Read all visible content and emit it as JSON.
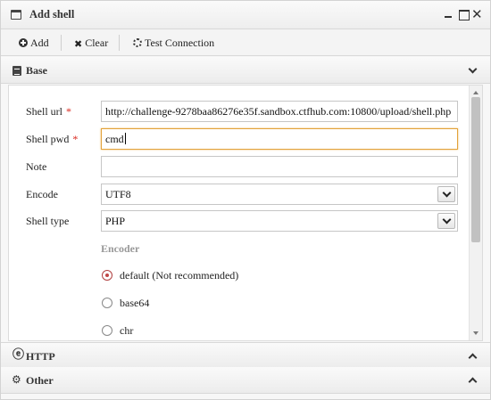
{
  "window": {
    "title": "Add shell",
    "controls": {
      "minimize_icon": "minimize-icon",
      "maximize_icon": "maximize-icon",
      "close_glyph": "✕"
    }
  },
  "toolbar": {
    "add_label": "Add",
    "clear_label": "Clear",
    "clear_glyph": "✖",
    "test_label": "Test Connection"
  },
  "sections": {
    "base": {
      "title": "Base",
      "icon": "document-icon",
      "state": "expanded"
    },
    "http": {
      "title": "HTTP",
      "icon_glyph": "ⓔ",
      "state": "collapsed"
    },
    "other": {
      "title": "Other",
      "icon_glyph": "⚙",
      "state": "collapsed"
    }
  },
  "form": {
    "shell_url": {
      "label": "Shell url",
      "required_mark": "*",
      "value": "http://challenge-9278baa86276e35f.sandbox.ctfhub.com:10800/upload/shell.php"
    },
    "shell_pwd": {
      "label": "Shell pwd",
      "required_mark": "*",
      "value": "cmd"
    },
    "note": {
      "label": "Note",
      "value": ""
    },
    "encode": {
      "label": "Encode",
      "value": "UTF8"
    },
    "shell_type": {
      "label": "Shell type",
      "value": "PHP"
    },
    "encoder": {
      "label": "Encoder",
      "options": [
        {
          "label": "default (Not recommended)",
          "checked": true
        },
        {
          "label": "base64",
          "checked": false
        },
        {
          "label": "chr",
          "checked": false
        }
      ]
    }
  },
  "colors": {
    "required": "#d9261c",
    "focus_border": "#e2a23a",
    "radio_checked": "#c04444"
  }
}
